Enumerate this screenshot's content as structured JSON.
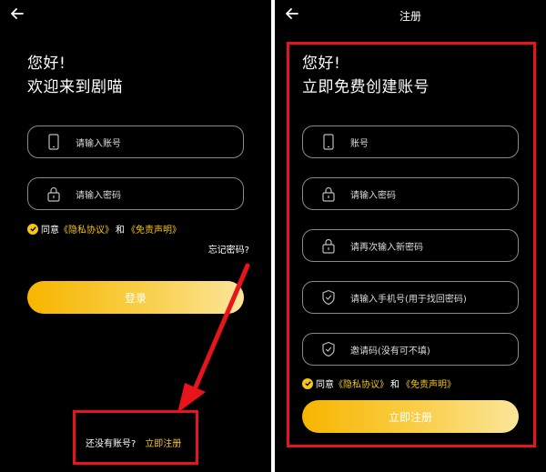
{
  "login_screen": {
    "greeting_line1": "您好!",
    "greeting_line2": "欢迎来到剧喵",
    "account_placeholder": "请输入账号",
    "password_placeholder": "请输入密码",
    "agree_prefix": "同意",
    "privacy_link": "《隐私协议》",
    "and_text": "和",
    "disclaimer_link": "《免责声明》",
    "forgot_password": "忘记密码?",
    "login_button": "登录",
    "no_account_text": "还没有账号?",
    "register_link": "立即注册"
  },
  "register_screen": {
    "title": "注册",
    "greeting_line1": "您好!",
    "greeting_line2": "立即免费创建账号",
    "account_placeholder": "账号",
    "password_placeholder": "请输入密码",
    "confirm_password_placeholder": "请再次输入新密码",
    "phone_placeholder": "请输入手机号(用于找回密码)",
    "invite_placeholder": "邀请码(没有可不填)",
    "agree_prefix": "同意",
    "privacy_link": "《隐私协议》",
    "and_text": "和",
    "disclaimer_link": "《免责声明》",
    "register_button": "立即注册"
  },
  "colors": {
    "background": "#000000",
    "accent": "#f5c518",
    "annotation": "#e8141c"
  }
}
